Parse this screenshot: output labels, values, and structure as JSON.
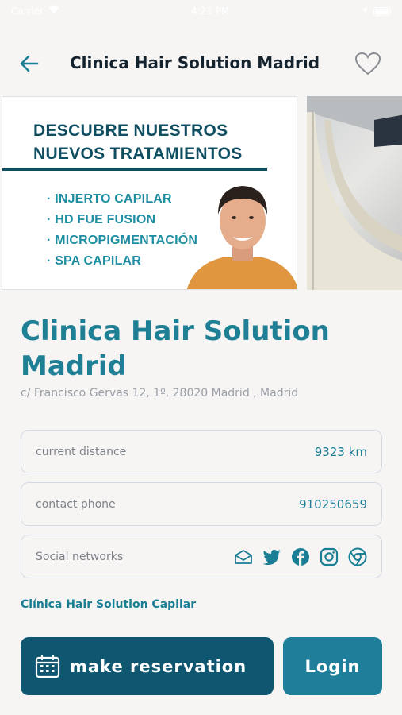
{
  "status_bar": {
    "carrier": "Carrier",
    "time": "4:23 PM"
  },
  "header": {
    "title": "Clinica Hair Solution Madrid",
    "back_icon": "arrow-left-icon",
    "favorite_icon": "heart-outline-icon"
  },
  "gallery": {
    "promo": {
      "headline_line1": "DESCUBRE NUESTROS",
      "headline_line2": "NUEVOS TRATAMIENTOS",
      "treatments": [
        "INJERTO CAPILAR",
        "HD FUE FUSION",
        "MICROPIGMENTACIÓN",
        "SPA CAPILAR"
      ]
    }
  },
  "place": {
    "name": "Clinica Hair Solution Madrid",
    "address": "c/ Francisco Gervas 12, 1º, 28020 Madrid , Madrid"
  },
  "info": {
    "distance_label": "current distance",
    "distance_value": "9323 km",
    "phone_label": "contact phone",
    "phone_value": "910250659",
    "social_label": "Social networks",
    "social_icons": [
      "email-icon",
      "twitter-icon",
      "facebook-icon",
      "instagram-icon",
      "chrome-icon"
    ]
  },
  "link": {
    "label": "Clínica Hair Solution Capilar"
  },
  "actions": {
    "reserve_label": "make reservation",
    "reserve_icon": "calendar-icon",
    "login_label": "Login"
  },
  "colors": {
    "background": "#f7f5f4",
    "accent": "#1f7f95",
    "primary_button": "#0f5670",
    "secondary_button": "#1f7f9a",
    "card_border": "#d4d9e4"
  }
}
